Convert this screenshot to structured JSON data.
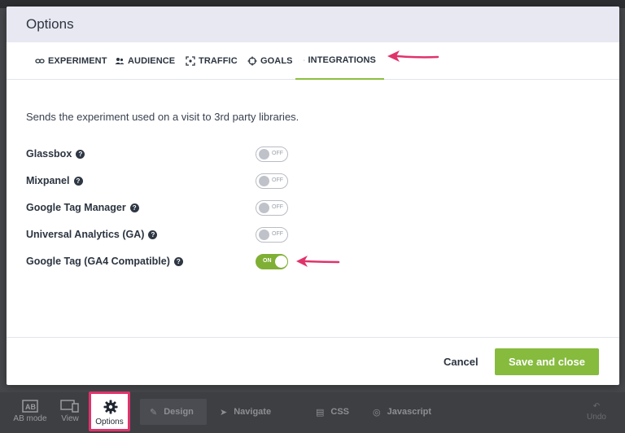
{
  "modal": {
    "title": "Options",
    "tabs": [
      {
        "label": "EXPERIMENT",
        "icon": "link-icon"
      },
      {
        "label": "AUDIENCE",
        "icon": "users-icon"
      },
      {
        "label": "TRAFFIC",
        "icon": "traffic-icon"
      },
      {
        "label": "GOALS",
        "icon": "target-icon"
      },
      {
        "label": "INTEGRATIONS",
        "icon": "bell-icon",
        "active": true
      }
    ],
    "description": "Sends the experiment used on a visit to 3rd party libraries.",
    "integrations": [
      {
        "label": "Glassbox",
        "state": "OFF"
      },
      {
        "label": "Mixpanel",
        "state": "OFF"
      },
      {
        "label": "Google Tag Manager",
        "state": "OFF"
      },
      {
        "label": "Universal Analytics (GA)",
        "state": "OFF"
      },
      {
        "label": "Google Tag (GA4 Compatible)",
        "state": "ON"
      }
    ],
    "help_glyph": "?",
    "footer": {
      "cancel_label": "Cancel",
      "save_label": "Save and close"
    }
  },
  "toolbar": {
    "ab_mode_label": "AB mode",
    "view_label": "View",
    "options_label": "Options",
    "design_label": "Design",
    "navigate_label": "Navigate",
    "css_label": "CSS",
    "javascript_label": "Javascript",
    "undo_label": "Undo"
  },
  "colors": {
    "accent_green": "#86bb3e",
    "highlight_pink": "#e0336b",
    "header_bg": "#e7e8f1"
  }
}
